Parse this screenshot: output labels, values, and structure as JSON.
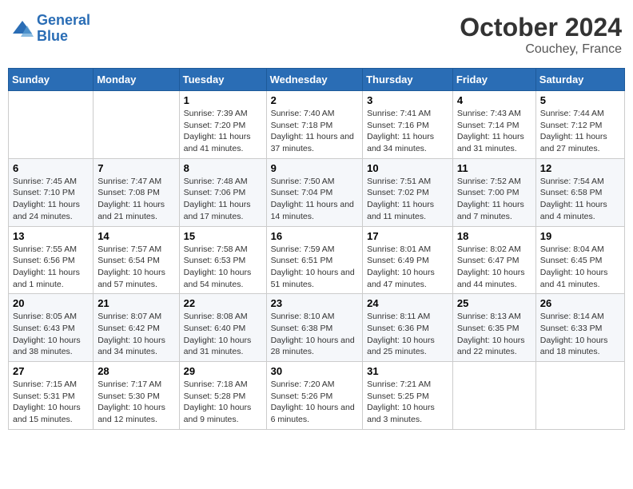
{
  "logo": {
    "line1": "General",
    "line2": "Blue"
  },
  "header": {
    "month": "October 2024",
    "location": "Couchey, France"
  },
  "weekdays": [
    "Sunday",
    "Monday",
    "Tuesday",
    "Wednesday",
    "Thursday",
    "Friday",
    "Saturday"
  ],
  "weeks": [
    [
      {
        "day": "",
        "sunrise": "",
        "sunset": "",
        "daylight": ""
      },
      {
        "day": "",
        "sunrise": "",
        "sunset": "",
        "daylight": ""
      },
      {
        "day": "1",
        "sunrise": "Sunrise: 7:39 AM",
        "sunset": "Sunset: 7:20 PM",
        "daylight": "Daylight: 11 hours and 41 minutes."
      },
      {
        "day": "2",
        "sunrise": "Sunrise: 7:40 AM",
        "sunset": "Sunset: 7:18 PM",
        "daylight": "Daylight: 11 hours and 37 minutes."
      },
      {
        "day": "3",
        "sunrise": "Sunrise: 7:41 AM",
        "sunset": "Sunset: 7:16 PM",
        "daylight": "Daylight: 11 hours and 34 minutes."
      },
      {
        "day": "4",
        "sunrise": "Sunrise: 7:43 AM",
        "sunset": "Sunset: 7:14 PM",
        "daylight": "Daylight: 11 hours and 31 minutes."
      },
      {
        "day": "5",
        "sunrise": "Sunrise: 7:44 AM",
        "sunset": "Sunset: 7:12 PM",
        "daylight": "Daylight: 11 hours and 27 minutes."
      }
    ],
    [
      {
        "day": "6",
        "sunrise": "Sunrise: 7:45 AM",
        "sunset": "Sunset: 7:10 PM",
        "daylight": "Daylight: 11 hours and 24 minutes."
      },
      {
        "day": "7",
        "sunrise": "Sunrise: 7:47 AM",
        "sunset": "Sunset: 7:08 PM",
        "daylight": "Daylight: 11 hours and 21 minutes."
      },
      {
        "day": "8",
        "sunrise": "Sunrise: 7:48 AM",
        "sunset": "Sunset: 7:06 PM",
        "daylight": "Daylight: 11 hours and 17 minutes."
      },
      {
        "day": "9",
        "sunrise": "Sunrise: 7:50 AM",
        "sunset": "Sunset: 7:04 PM",
        "daylight": "Daylight: 11 hours and 14 minutes."
      },
      {
        "day": "10",
        "sunrise": "Sunrise: 7:51 AM",
        "sunset": "Sunset: 7:02 PM",
        "daylight": "Daylight: 11 hours and 11 minutes."
      },
      {
        "day": "11",
        "sunrise": "Sunrise: 7:52 AM",
        "sunset": "Sunset: 7:00 PM",
        "daylight": "Daylight: 11 hours and 7 minutes."
      },
      {
        "day": "12",
        "sunrise": "Sunrise: 7:54 AM",
        "sunset": "Sunset: 6:58 PM",
        "daylight": "Daylight: 11 hours and 4 minutes."
      }
    ],
    [
      {
        "day": "13",
        "sunrise": "Sunrise: 7:55 AM",
        "sunset": "Sunset: 6:56 PM",
        "daylight": "Daylight: 11 hours and 1 minute."
      },
      {
        "day": "14",
        "sunrise": "Sunrise: 7:57 AM",
        "sunset": "Sunset: 6:54 PM",
        "daylight": "Daylight: 10 hours and 57 minutes."
      },
      {
        "day": "15",
        "sunrise": "Sunrise: 7:58 AM",
        "sunset": "Sunset: 6:53 PM",
        "daylight": "Daylight: 10 hours and 54 minutes."
      },
      {
        "day": "16",
        "sunrise": "Sunrise: 7:59 AM",
        "sunset": "Sunset: 6:51 PM",
        "daylight": "Daylight: 10 hours and 51 minutes."
      },
      {
        "day": "17",
        "sunrise": "Sunrise: 8:01 AM",
        "sunset": "Sunset: 6:49 PM",
        "daylight": "Daylight: 10 hours and 47 minutes."
      },
      {
        "day": "18",
        "sunrise": "Sunrise: 8:02 AM",
        "sunset": "Sunset: 6:47 PM",
        "daylight": "Daylight: 10 hours and 44 minutes."
      },
      {
        "day": "19",
        "sunrise": "Sunrise: 8:04 AM",
        "sunset": "Sunset: 6:45 PM",
        "daylight": "Daylight: 10 hours and 41 minutes."
      }
    ],
    [
      {
        "day": "20",
        "sunrise": "Sunrise: 8:05 AM",
        "sunset": "Sunset: 6:43 PM",
        "daylight": "Daylight: 10 hours and 38 minutes."
      },
      {
        "day": "21",
        "sunrise": "Sunrise: 8:07 AM",
        "sunset": "Sunset: 6:42 PM",
        "daylight": "Daylight: 10 hours and 34 minutes."
      },
      {
        "day": "22",
        "sunrise": "Sunrise: 8:08 AM",
        "sunset": "Sunset: 6:40 PM",
        "daylight": "Daylight: 10 hours and 31 minutes."
      },
      {
        "day": "23",
        "sunrise": "Sunrise: 8:10 AM",
        "sunset": "Sunset: 6:38 PM",
        "daylight": "Daylight: 10 hours and 28 minutes."
      },
      {
        "day": "24",
        "sunrise": "Sunrise: 8:11 AM",
        "sunset": "Sunset: 6:36 PM",
        "daylight": "Daylight: 10 hours and 25 minutes."
      },
      {
        "day": "25",
        "sunrise": "Sunrise: 8:13 AM",
        "sunset": "Sunset: 6:35 PM",
        "daylight": "Daylight: 10 hours and 22 minutes."
      },
      {
        "day": "26",
        "sunrise": "Sunrise: 8:14 AM",
        "sunset": "Sunset: 6:33 PM",
        "daylight": "Daylight: 10 hours and 18 minutes."
      }
    ],
    [
      {
        "day": "27",
        "sunrise": "Sunrise: 7:15 AM",
        "sunset": "Sunset: 5:31 PM",
        "daylight": "Daylight: 10 hours and 15 minutes."
      },
      {
        "day": "28",
        "sunrise": "Sunrise: 7:17 AM",
        "sunset": "Sunset: 5:30 PM",
        "daylight": "Daylight: 10 hours and 12 minutes."
      },
      {
        "day": "29",
        "sunrise": "Sunrise: 7:18 AM",
        "sunset": "Sunset: 5:28 PM",
        "daylight": "Daylight: 10 hours and 9 minutes."
      },
      {
        "day": "30",
        "sunrise": "Sunrise: 7:20 AM",
        "sunset": "Sunset: 5:26 PM",
        "daylight": "Daylight: 10 hours and 6 minutes."
      },
      {
        "day": "31",
        "sunrise": "Sunrise: 7:21 AM",
        "sunset": "Sunset: 5:25 PM",
        "daylight": "Daylight: 10 hours and 3 minutes."
      },
      {
        "day": "",
        "sunrise": "",
        "sunset": "",
        "daylight": ""
      },
      {
        "day": "",
        "sunrise": "",
        "sunset": "",
        "daylight": ""
      }
    ]
  ]
}
